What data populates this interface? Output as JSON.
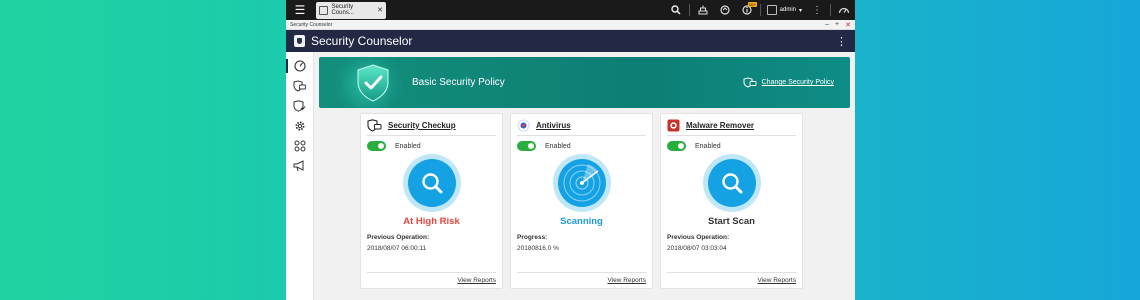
{
  "taskbar": {
    "tab_label": "Security Couns...",
    "notification_badge": "10+",
    "user": "admin"
  },
  "window": {
    "title": "Security Counselor"
  },
  "app": {
    "title": "Security Counselor"
  },
  "banner": {
    "title": "Basic Security Policy",
    "link": "Change Security Policy"
  },
  "cards": [
    {
      "title": "Security Checkup",
      "toggle": "Enabled",
      "status": "At High Risk",
      "status_color": "#e8453c",
      "info_label": "Previous Operation:",
      "info_value": "2018/08/07 06:00:11",
      "footer": "View Reports"
    },
    {
      "title": "Antivirus",
      "toggle": "Enabled",
      "status": "Scanning",
      "status_color": "#1b9ad6",
      "info_label": "Progress:",
      "info_value": "20180816.0 %",
      "footer": "View Reports"
    },
    {
      "title": "Malware Remover",
      "toggle": "Enabled",
      "status": "Start Scan",
      "status_color": "#333333",
      "info_label": "Previous Operation:",
      "info_value": "2018/08/07 03:03:04",
      "footer": "View Reports"
    }
  ],
  "colors": {
    "header_bg": "#232845",
    "banner_teal": "#0d7f74",
    "toggle_green": "#27ae3f",
    "scan_blue": "#14a2e4"
  }
}
